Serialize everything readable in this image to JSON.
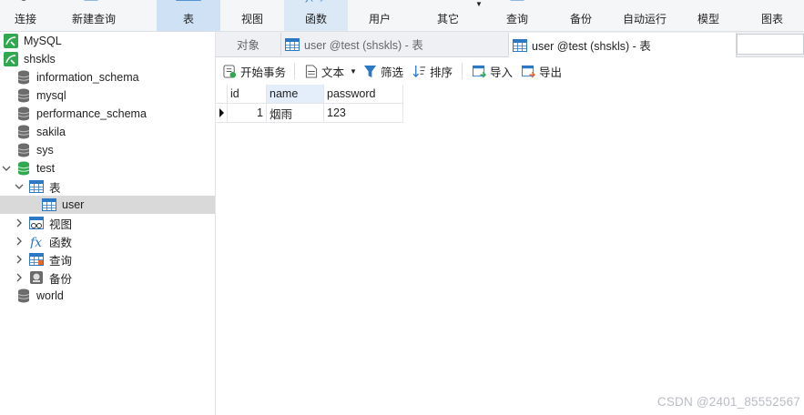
{
  "toolbar": {
    "buttons": [
      {
        "label": "连接",
        "icon": "connect-icon"
      },
      {
        "label": "新建查询",
        "icon": "new-query-icon"
      },
      {
        "label": "表",
        "icon": "table-icon"
      },
      {
        "label": "视图",
        "icon": "view-icon"
      },
      {
        "label": "函数",
        "icon": "function-icon"
      },
      {
        "label": "用户",
        "icon": "user-icon"
      },
      {
        "label": "其它",
        "icon": "other-icon"
      },
      {
        "label": "查询",
        "icon": "query-icon"
      },
      {
        "label": "备份",
        "icon": "backup-icon"
      },
      {
        "label": "自动运行",
        "icon": "auto-run-icon"
      },
      {
        "label": "模型",
        "icon": "model-icon"
      },
      {
        "label": "图表",
        "icon": "chart-icon"
      }
    ],
    "active": "表"
  },
  "tree": {
    "connections": [
      {
        "label": "MySQL",
        "icon": "mysql-connection-icon"
      },
      {
        "label": "shskls",
        "icon": "mysql-connection-icon"
      }
    ],
    "databases": [
      {
        "label": "information_schema"
      },
      {
        "label": "mysql"
      },
      {
        "label": "performance_schema"
      },
      {
        "label": "sakila"
      },
      {
        "label": "sys"
      },
      {
        "label": "test",
        "open": true
      },
      {
        "label": "world"
      }
    ],
    "test_children": [
      {
        "label": "表",
        "icon": "table-folder-icon",
        "open": true
      },
      {
        "label": "视图",
        "icon": "view-folder-icon"
      },
      {
        "label": "函数",
        "icon": "function-folder-icon"
      },
      {
        "label": "查询",
        "icon": "query-folder-icon"
      },
      {
        "label": "备份",
        "icon": "backup-folder-icon"
      }
    ],
    "tables": [
      {
        "label": "user",
        "selected": true
      }
    ]
  },
  "tabs": [
    {
      "label": "对象"
    },
    {
      "label": "user @test (shskls) - 表"
    },
    {
      "label": "user @test (shskls) - 表",
      "active": true
    }
  ],
  "content_toolbar": {
    "begin_transaction": "开始事务",
    "text": "文本",
    "filter": "筛选",
    "sort": "排序",
    "import": "导入",
    "export": "导出"
  },
  "grid": {
    "columns": [
      "id",
      "name",
      "password"
    ],
    "rows": [
      [
        "1",
        "烟雨",
        "123"
      ]
    ]
  },
  "watermark": "CSDN @2401_85552567",
  "colors": {
    "accent": "#2b78c5",
    "db_green": "#2fa84f",
    "selected_row": "#d9d9d9"
  }
}
